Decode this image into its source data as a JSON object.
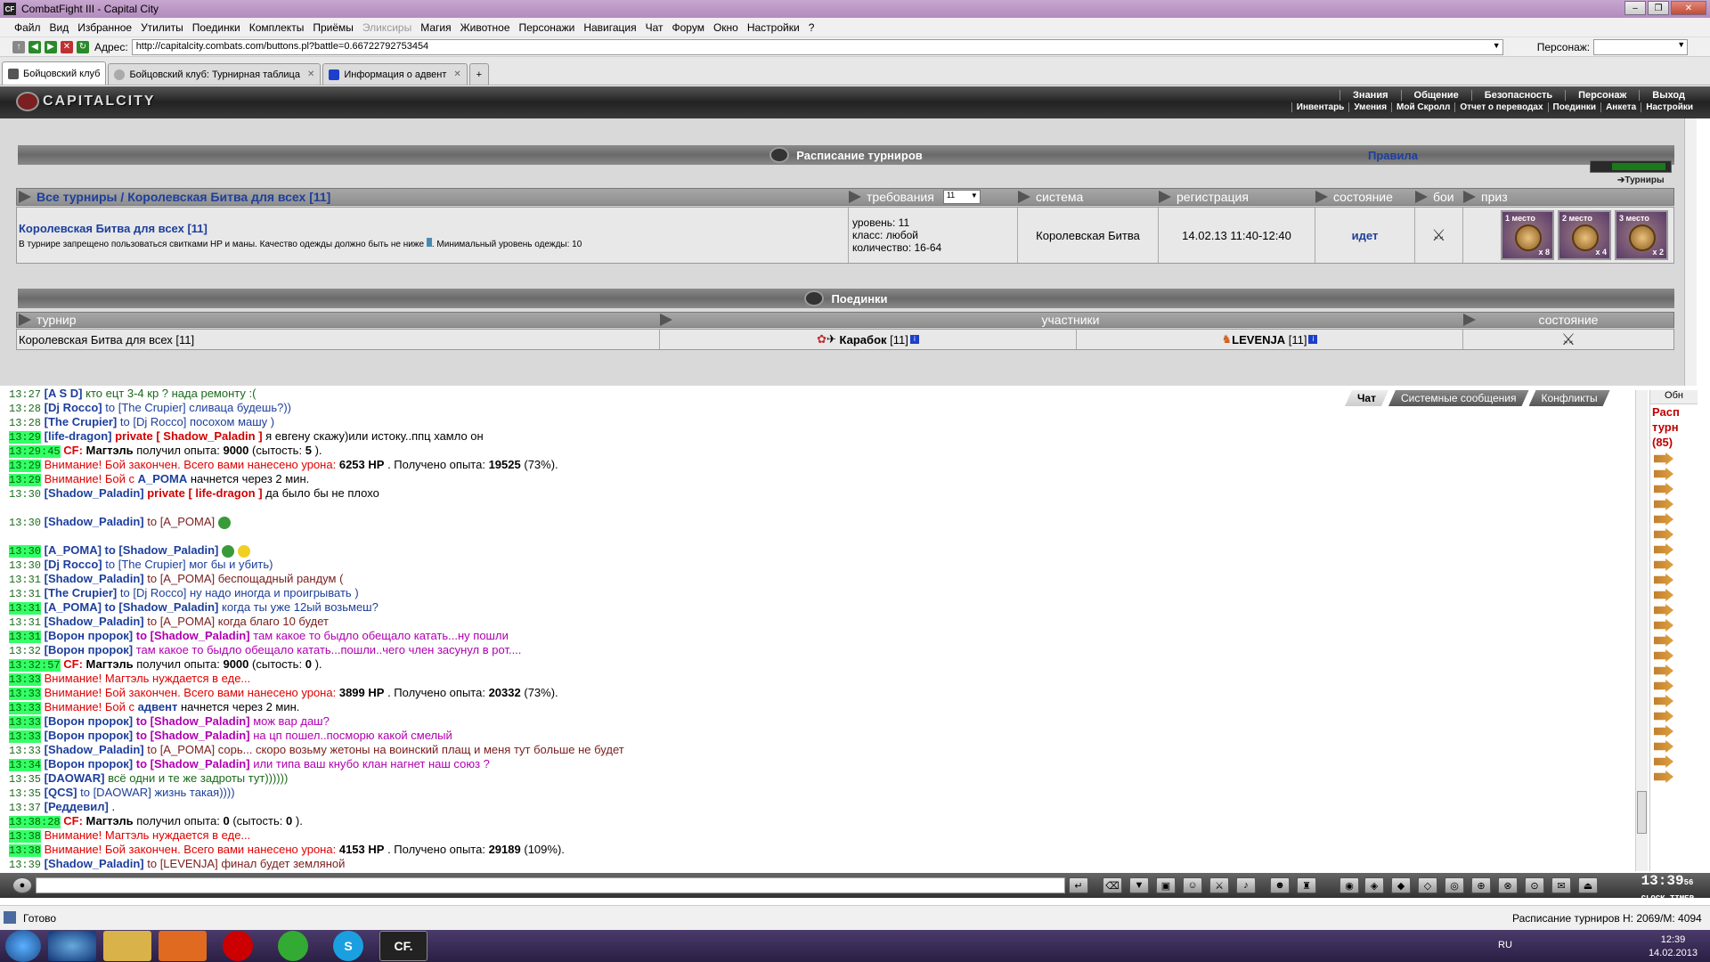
{
  "window": {
    "title": "CombatFight III - Capital City"
  },
  "menu": [
    "Файл",
    "Вид",
    "Избранное",
    "Утилиты",
    "Поединки",
    "Комплекты",
    "Приёмы",
    "Эликсиры",
    "Магия",
    "Животное",
    "Персонажи",
    "Навигация",
    "Чат",
    "Форум",
    "Окно",
    "Настройки",
    "?"
  ],
  "address": {
    "label": "Адрес:",
    "url": "http://capitalcity.combats.com/buttons.pl?battle=0.66722792753454",
    "persona_label": "Персонаж:"
  },
  "tabs": [
    {
      "label": "Бойцовский клуб"
    },
    {
      "label": "Бойцовский клуб: Турнирная таблица"
    },
    {
      "label": "Информация о адвент"
    }
  ],
  "game": {
    "logo": "CAPITALCITY",
    "top_menu": [
      "Знания",
      "Общение",
      "Безопасность",
      "Персонаж",
      "Выход"
    ],
    "sub_menu": [
      "Инвентарь",
      "Умения",
      "Мой Скролл",
      "Отчет о переводах",
      "Поединки",
      "Анкета",
      "Настройки"
    ]
  },
  "schedule": {
    "title": "Расписание турниров",
    "rules": "Правила",
    "turnirs_link": "Турниры",
    "breadcrumb_all": "Все турниры",
    "breadcrumb_sep": "/",
    "breadcrumb_current": "Королевская Битва для всех [11]",
    "col_requirements": "требования",
    "level_select": "11",
    "col_system": "система",
    "col_registration": "регистрация",
    "col_state": "состояние",
    "col_fights": "бои",
    "col_prize": "приз",
    "row": {
      "name": "Королевская Битва для всех [11]",
      "note": "В турнире запрещено пользоваться свитками HP и маны. Качество одежды должно быть не ниже",
      "note2": ". Минимальный уровень одежды: 10",
      "req_level": "уровень: 11",
      "req_class": "класс: любой",
      "req_count": "количество: 16-64",
      "system": "Королевская Битва",
      "registration": "14.02.13 11:40-12:40",
      "state": "идет",
      "prizes": [
        {
          "place": "1 место",
          "count": "x 8"
        },
        {
          "place": "2 место",
          "count": "x 4"
        },
        {
          "place": "3 место",
          "count": "x 2"
        }
      ]
    }
  },
  "duels": {
    "title": "Поединки",
    "col_tournament": "турнир",
    "col_participants": "участники",
    "col_state": "состояние",
    "row": {
      "tournament": "Королевская Битва для всех [11]",
      "p1": "Карабок",
      "p1_level": "[11]",
      "p2": "LEVENJA",
      "p2_level": "[11]"
    }
  },
  "chat_tabs": [
    "Чат",
    "Системные сообщения",
    "Конфликты"
  ],
  "chat": [
    {
      "t": "13:27",
      "hl": false,
      "nick": "[A S D]",
      "to": "",
      "msg": "кто ецт 3-4 кр ? нада ремонту :(",
      "cls": "msg-green"
    },
    {
      "t": "13:28",
      "hl": false,
      "nick": "[Dj Rocco]",
      "to": "to [The Crupier]",
      "msg": "сливаца будешь?))",
      "cls": "msg-blue"
    },
    {
      "t": "13:28",
      "hl": false,
      "nick": "[The Crupier]",
      "to": "to [Dj Rocco]",
      "msg": "посохом машу )",
      "cls": "msg-blue"
    },
    {
      "t": "13:29",
      "hl": true,
      "nick": "[life-dragon]",
      "to": "private [ Shadow_Paladin ]",
      "priv": true,
      "msg": "я евгену скажу)или истоку..ппц хамло он",
      "cls": "msg-black"
    },
    {
      "t": "13:29:45",
      "hl": true,
      "sys": "cf",
      "pre": "CF:",
      "bold1": "Магтэль",
      "msg": "получил опыта:",
      "v1": "9000",
      "rest": "(сытость:",
      "v2": "5",
      "end": ")."
    },
    {
      "t": "13:29",
      "hl": true,
      "sys": "warn",
      "pre": "Внимание!",
      "msg": "Бой закончен. Всего вами нанесено урона:",
      "v1": "6253 HP",
      "rest": ". Получено опыта:",
      "v2": "19525",
      "end": "(73%)."
    },
    {
      "t": "13:29",
      "hl": true,
      "sys": "warn",
      "pre": "Внимание!",
      "msg": "Бой с",
      "v1": "A_POMA",
      "rest": "начнется через 2 мин.",
      "v2": "",
      "end": ""
    },
    {
      "t": "13:30",
      "hl": false,
      "nick": "[Shadow_Paladin]",
      "to": "private [ life-dragon ]",
      "priv": true,
      "msg": "да было бы не плохо",
      "cls": "msg-black"
    },
    {
      "t": "13:30",
      "hl": false,
      "nick": "[Shadow_Paladin]",
      "to": "to [A_POMA]",
      "msg": "",
      "cls": "msg-brown",
      "smiles": 1
    },
    {
      "t": "13:30",
      "hl": true,
      "nick": "[A_POMA]",
      "to": "to [Shadow_Paladin]",
      "bold_to": true,
      "msg": "",
      "cls": "msg-blue",
      "smiles": 2
    },
    {
      "t": "13:30",
      "hl": false,
      "nick": "[Dj Rocco]",
      "to": "to [The Crupier]",
      "msg": "мог бы и убить)",
      "cls": "msg-blue"
    },
    {
      "t": "13:31",
      "hl": false,
      "nick": "[Shadow_Paladin]",
      "to": "to [A_POMA]",
      "msg": "беспощадный рандум (",
      "cls": "msg-brown"
    },
    {
      "t": "13:31",
      "hl": false,
      "nick": "[The Crupier]",
      "to": "to [Dj Rocco]",
      "msg": "ну надо иногда и проигрывать )",
      "cls": "msg-blue"
    },
    {
      "t": "13:31",
      "hl": true,
      "nick": "[A_POMA]",
      "to": "to [Shadow_Paladin]",
      "bold_to": true,
      "msg": "когда ты уже 12ый возьмеш?",
      "cls": "msg-blue"
    },
    {
      "t": "13:31",
      "hl": false,
      "nick": "[Shadow_Paladin]",
      "to": "to [A_POMA]",
      "msg": "когда благо 10 будет",
      "cls": "msg-brown"
    },
    {
      "t": "13:31",
      "hl": true,
      "nick": "[Ворон пророк]",
      "to": "to [Shadow_Paladin]",
      "bold_to": true,
      "msg": "там какое то быдло обещало катать...ну пошли",
      "cls": "msg-mag"
    },
    {
      "t": "13:32",
      "hl": false,
      "nick": "[Ворон пророк]",
      "to": "",
      "msg": "там какое то быдло обещало катать...пошли..чего член засунул в рот....",
      "cls": "msg-mag"
    },
    {
      "t": "13:32:57",
      "hl": true,
      "sys": "cf",
      "pre": "CF:",
      "bold1": "Магтэль",
      "msg": "получил опыта:",
      "v1": "9000",
      "rest": "(сытость:",
      "v2": "0",
      "end": ")."
    },
    {
      "t": "13:33",
      "hl": true,
      "sys": "warn",
      "pre": "Внимание!",
      "msg": "Магтэль нуждается в еде...",
      "v1": "",
      "rest": "",
      "v2": "",
      "end": ""
    },
    {
      "t": "13:33",
      "hl": true,
      "sys": "warn",
      "pre": "Внимание!",
      "msg": "Бой закончен. Всего вами нанесено урона:",
      "v1": "3899 HP",
      "rest": ". Получено опыта:",
      "v2": "20332",
      "end": "(73%)."
    },
    {
      "t": "13:33",
      "hl": true,
      "sys": "warn",
      "pre": "Внимание!",
      "msg": "Бой с",
      "v1": "адвент",
      "rest": "начнется через 2 мин.",
      "v2": "",
      "end": ""
    },
    {
      "t": "13:33",
      "hl": true,
      "nick": "[Ворон пророк]",
      "to": "to [Shadow_Paladin]",
      "bold_to": true,
      "msg": "мож вар даш?",
      "cls": "msg-mag"
    },
    {
      "t": "13:33",
      "hl": true,
      "nick": "[Ворон пророк]",
      "to": "to [Shadow_Paladin]",
      "bold_to": true,
      "msg": "на цп пошел..посморю какой смелый",
      "cls": "msg-mag"
    },
    {
      "t": "13:33",
      "hl": false,
      "nick": "[Shadow_Paladin]",
      "to": "to [A_POMA]",
      "msg": "сорь... скоро возьму жетоны на воинский плащ и меня тут больше не будет",
      "cls": "msg-brown"
    },
    {
      "t": "13:34",
      "hl": true,
      "nick": "[Ворон пророк]",
      "to": "to [Shadow_Paladin]",
      "bold_to": true,
      "msg": "или типа ваш кнубо клан нагнет наш союз ?",
      "cls": "msg-mag"
    },
    {
      "t": "13:35",
      "hl": false,
      "nick": "[DAOWAR]",
      "to": "",
      "msg": "всё одни и те же задроты тут))))))",
      "cls": "msg-green"
    },
    {
      "t": "13:35",
      "hl": false,
      "nick": "[QCS]",
      "to": "to [DAOWAR]",
      "msg": "жизнь такая))))",
      "cls": "msg-blue"
    },
    {
      "t": "13:37",
      "hl": false,
      "nick": "[Реддевил]",
      "to": "",
      "msg": ".",
      "cls": "msg-black"
    },
    {
      "t": "13:38:28",
      "hl": true,
      "sys": "cf",
      "pre": "CF:",
      "bold1": "Магтэль",
      "msg": "получил опыта:",
      "v1": "0",
      "rest": "(сытость:",
      "v2": "0",
      "end": ")."
    },
    {
      "t": "13:38",
      "hl": true,
      "sys": "warn",
      "pre": "Внимание!",
      "msg": "Магтэль нуждается в еде...",
      "v1": "",
      "rest": "",
      "v2": "",
      "end": ""
    },
    {
      "t": "13:38",
      "hl": true,
      "sys": "warn",
      "pre": "Внимание!",
      "msg": "Бой закончен. Всего вами нанесено урона:",
      "v1": "4153 HP",
      "rest": ". Получено опыта:",
      "v2": "29189",
      "end": "(109%)."
    },
    {
      "t": "13:39",
      "hl": false,
      "nick": "[Shadow_Paladin]",
      "to": "to [LEVENJA]",
      "msg": "финал будет земляной",
      "cls": "msg-brown"
    }
  ],
  "right_panel": {
    "refresh": "Обн",
    "title_lines": [
      "Расп",
      "турн",
      "(85)"
    ]
  },
  "clock": {
    "time": "13:39",
    "sec": "56",
    "sub": "CLOCK TIMER"
  },
  "statusbar": {
    "ready": "Готово",
    "tab": "Расписание турниров",
    "mem": "Н: 2069/М: 4094"
  },
  "taskbar": {
    "lang": "RU",
    "time": "12:39",
    "date": "14.02.2013",
    "cf": "CF."
  }
}
